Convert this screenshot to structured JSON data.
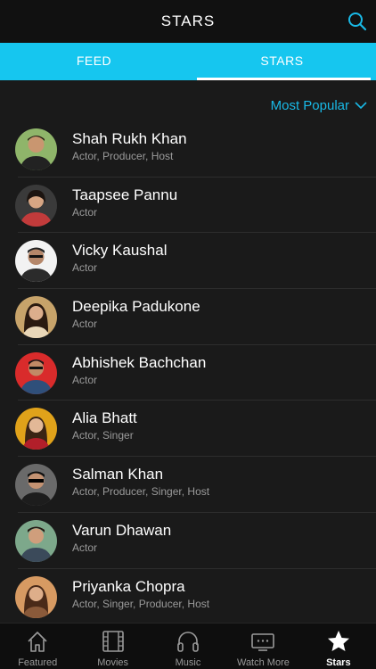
{
  "header": {
    "title": "STARS",
    "search_icon": "search-icon"
  },
  "tabs": [
    {
      "label": "FEED",
      "active": false
    },
    {
      "label": "STARS",
      "active": true
    }
  ],
  "sort": {
    "label": "Most Popular",
    "icon": "chevron-down-icon"
  },
  "stars": [
    {
      "name": "Shah Rukh Khan",
      "role": "Actor, Producer, Host",
      "avatar_bg": "#8fb56a"
    },
    {
      "name": "Taapsee Pannu",
      "role": "Actor",
      "avatar_bg": "#3a3a3a"
    },
    {
      "name": "Vicky Kaushal",
      "role": "Actor",
      "avatar_bg": "#f2f2f2"
    },
    {
      "name": "Deepika Padukone",
      "role": "Actor",
      "avatar_bg": "#c7a36a"
    },
    {
      "name": "Abhishek Bachchan",
      "role": "Actor",
      "avatar_bg": "#d92b2b"
    },
    {
      "name": "Alia Bhatt",
      "role": "Actor, Singer",
      "avatar_bg": "#e0a21a"
    },
    {
      "name": "Salman Khan",
      "role": "Actor, Producer, Singer, Host",
      "avatar_bg": "#6a6a6a"
    },
    {
      "name": "Varun Dhawan",
      "role": "Actor",
      "avatar_bg": "#7da88b"
    },
    {
      "name": "Priyanka Chopra",
      "role": "Actor, Singer, Producer, Host",
      "avatar_bg": "#d79a62"
    }
  ],
  "bottom_nav": [
    {
      "label": "Featured",
      "icon": "home-icon",
      "active": false
    },
    {
      "label": "Movies",
      "icon": "film-icon",
      "active": false
    },
    {
      "label": "Music",
      "icon": "headphones-icon",
      "active": false
    },
    {
      "label": "Watch More",
      "icon": "tv-icon",
      "active": false
    },
    {
      "label": "Stars",
      "icon": "star-icon",
      "active": true
    }
  ],
  "colors": {
    "accent": "#16c6ef",
    "background": "#1a1a1a",
    "header": "#111111"
  }
}
